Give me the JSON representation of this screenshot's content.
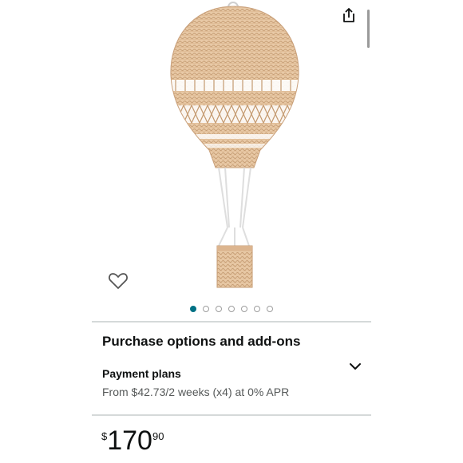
{
  "product": {
    "title": "Purchase options and add-ons",
    "image_name": "wicker-hot-air-balloon"
  },
  "gallery": {
    "total_images": 7,
    "active_index": 0
  },
  "payment": {
    "label": "Payment plans",
    "detail": "From $42.73/2 weeks (x4) at 0% APR"
  },
  "price": {
    "symbol": "$",
    "whole": "170",
    "fraction": "90"
  },
  "icons": {
    "share": "share-icon",
    "wishlist": "heart-outline-icon",
    "expand": "chevron-down-icon"
  },
  "colors": {
    "accent_dot": "#007185",
    "divider": "#d5d9d9",
    "text_primary": "#0f1111",
    "text_secondary": "#565959",
    "wicker_light": "#e8c9a6",
    "wicker_dark": "#c49a70"
  }
}
